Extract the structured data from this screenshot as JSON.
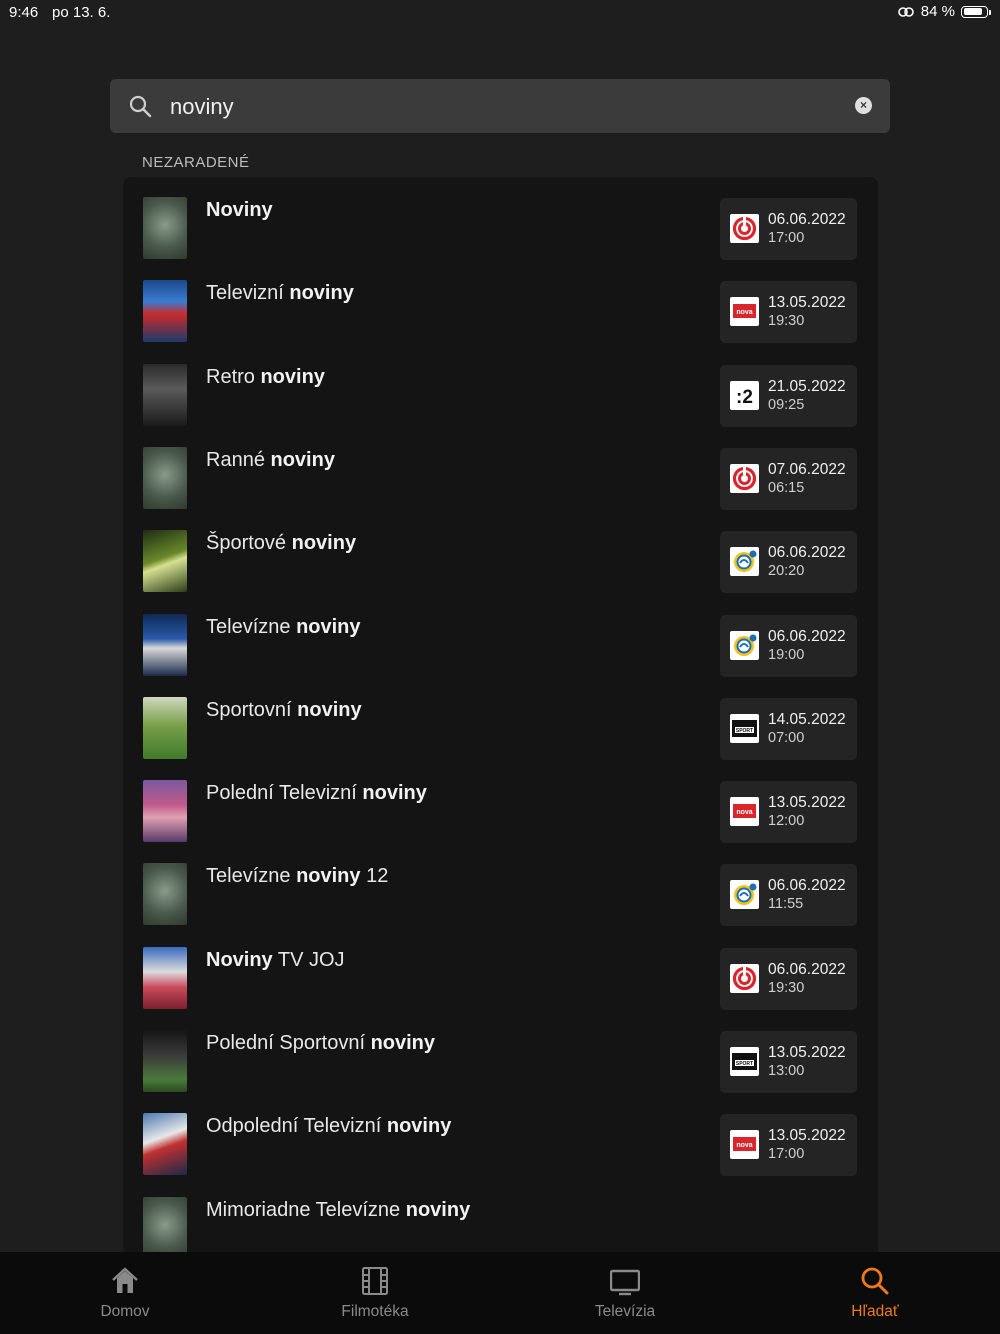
{
  "status_bar": {
    "time": "9:46",
    "date": "po 13. 6.",
    "battery": "84 %"
  },
  "search": {
    "value": "noviny",
    "placeholder": ""
  },
  "section_label": "NEZARADENÉ",
  "results": [
    {
      "pre": "",
      "bold": "Noviny",
      "post": "",
      "channel": "joj-icon",
      "date": "06.06.2022",
      "time": "17:00"
    },
    {
      "pre": "Televizní ",
      "bold": "noviny",
      "post": "",
      "channel": "nova-icon",
      "date": "13.05.2022",
      "time": "19:30"
    },
    {
      "pre": "Retro ",
      "bold": "noviny",
      "post": "",
      "channel": "dvojka-icon",
      "date": "21.05.2022",
      "time": "09:25"
    },
    {
      "pre": "Ranné ",
      "bold": "noviny",
      "post": "",
      "channel": "joj-icon",
      "date": "07.06.2022",
      "time": "06:15"
    },
    {
      "pre": "Športové ",
      "bold": "noviny",
      "post": "",
      "channel": "ta3-icon",
      "date": "06.06.2022",
      "time": "20:20"
    },
    {
      "pre": "Televízne ",
      "bold": "noviny",
      "post": "",
      "channel": "ta3-icon",
      "date": "06.06.2022",
      "time": "19:00"
    },
    {
      "pre": "Sportovní ",
      "bold": "noviny",
      "post": "",
      "channel": "sport-icon",
      "date": "14.05.2022",
      "time": "07:00"
    },
    {
      "pre": "Polední Televizní ",
      "bold": "noviny",
      "post": "",
      "channel": "nova-icon",
      "date": "13.05.2022",
      "time": "12:00"
    },
    {
      "pre": "Televízne ",
      "bold": "noviny",
      "post": " 12",
      "channel": "ta3-icon",
      "date": "06.06.2022",
      "time": "11:55"
    },
    {
      "pre": "",
      "bold": "Noviny",
      "post": " TV JOJ",
      "channel": "joj-icon",
      "date": "06.06.2022",
      "time": "19:30"
    },
    {
      "pre": "Polední Sportovní ",
      "bold": "noviny",
      "post": "",
      "channel": "sport-icon",
      "date": "13.05.2022",
      "time": "13:00"
    },
    {
      "pre": "Odpolední Televizní ",
      "bold": "noviny",
      "post": "",
      "channel": "nova-icon",
      "date": "13.05.2022",
      "time": "17:00"
    },
    {
      "pre": "Mimoriadne Televízne ",
      "bold": "noviny",
      "post": "",
      "channel": "",
      "date": "",
      "time": ""
    }
  ],
  "channel_logo_text": {
    "nova": "nova",
    "dvojka": ":2",
    "sport": "SPORT"
  },
  "tabs": [
    {
      "label": "Domov",
      "icon": "home-icon"
    },
    {
      "label": "Filmotéka",
      "icon": "film-icon"
    },
    {
      "label": "Televízia",
      "icon": "tv-icon"
    },
    {
      "label": "Hľadať",
      "icon": "search-icon"
    }
  ],
  "colors": {
    "accent": "#f07a1a",
    "background": "#1e1e1e",
    "panel": "#141414"
  }
}
